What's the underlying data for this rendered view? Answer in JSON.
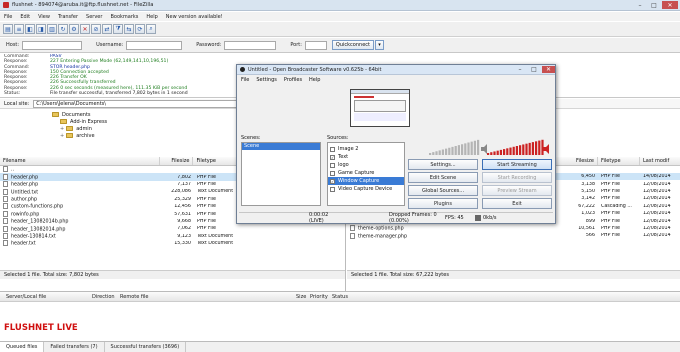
{
  "titlebar": {
    "title": "flushnet - 894074@aruba.it@ftp.flushnet.net - FileZilla"
  },
  "menu": [
    "File",
    "Edit",
    "View",
    "Transfer",
    "Server",
    "Bookmarks",
    "Help",
    "New version available!"
  ],
  "quickconnect": {
    "host_label": "Host:",
    "username_label": "Username:",
    "password_label": "Password:",
    "port_label": "Port:",
    "button": "Quickconnect"
  },
  "log": [
    {
      "k": "Command:",
      "v": "PASV",
      "t": "cmd"
    },
    {
      "k": "Response:",
      "v": "227 Entering Passive Mode (62,149,141,10,196,51)",
      "t": "ok"
    },
    {
      "k": "Command:",
      "v": "STOR header.php",
      "t": "cmd"
    },
    {
      "k": "Response:",
      "v": "150 Connection accepted",
      "t": "ok"
    },
    {
      "k": "Response:",
      "v": "226 Transfer OK",
      "t": "ok"
    },
    {
      "k": "Response:",
      "v": "226 Successfully transferred",
      "t": "ok"
    },
    {
      "k": "Response:",
      "v": "226 0 sec seconds (measured here), 111.35 KiB per second",
      "t": "ok"
    },
    {
      "k": "Status:",
      "v": "File transfer successful, transferred 7,802 bytes in 1 second",
      "t": "st"
    }
  ],
  "local": {
    "site_label": "Local site:",
    "path": "C:\\Users\\Jelena\\Documents\\",
    "tree": [
      "Documents",
      "Add-in Express",
      "admin",
      "archive"
    ],
    "columns": [
      "Filename",
      "Filesize",
      "Filetype"
    ],
    "files": [
      {
        "name": "..",
        "size": "",
        "type": ""
      },
      {
        "name": "header.php",
        "size": "7,802",
        "type": "PHP File",
        "sel": true
      },
      {
        "name": "header.php",
        "size": "7,137",
        "type": "PHP File"
      },
      {
        "name": "Untitled.txt",
        "size": "228,086",
        "type": "Text Document"
      },
      {
        "name": "author.php",
        "size": "25,329",
        "type": "PHP File"
      },
      {
        "name": "custom-functions.php",
        "size": "12,456",
        "type": "PHP File"
      },
      {
        "name": "rowinfo.php",
        "size": "57,631",
        "type": "PHP File"
      },
      {
        "name": "header_13082014b.php",
        "size": "9,668",
        "type": "PHP File"
      },
      {
        "name": "header_13082014.php",
        "size": "7,062",
        "type": "PHP File"
      },
      {
        "name": "header-130814.txt",
        "size": "9,123",
        "type": "Text Document"
      },
      {
        "name": "header.txt",
        "size": "15,330",
        "type": "Text Document"
      }
    ],
    "status": "Selected 1 file. Total size: 7,802 bytes"
  },
  "remote": {
    "columns": [
      "Filesize",
      "Filetype",
      "Last modif"
    ],
    "files": [
      {
        "name": "",
        "size": "6,450",
        "type": "PHP File",
        "mod": "14/08/2014",
        "sel": true
      },
      {
        "name": "",
        "size": "3,138",
        "type": "PHP File",
        "mod": "12/08/2014"
      },
      {
        "name": "",
        "size": "5,150",
        "type": "PHP File",
        "mod": "12/08/2014"
      },
      {
        "name": "",
        "size": "3,142",
        "type": "PHP File",
        "mod": "12/08/2014"
      },
      {
        "name": "",
        "size": "67,222",
        "type": "Cascading ...",
        "mod": "12/08/2014"
      },
      {
        "name": "wpdmanager.php",
        "size": "1,023",
        "type": "PHP File",
        "mod": "12/08/2014"
      },
      {
        "name": "tinytext.php",
        "size": "899",
        "type": "PHP File",
        "mod": "12/08/2014"
      },
      {
        "name": "theme-options.php",
        "size": "10,561",
        "type": "PHP File",
        "mod": "12/08/2014"
      },
      {
        "name": "theme-manager.php",
        "size": "566",
        "type": "PHP File",
        "mod": "12/08/2014"
      }
    ],
    "status": "Selected 1 file. Total size: 67,222 bytes"
  },
  "queue_cols": [
    "Server/Local file",
    "Direction",
    "Remote file",
    "Size",
    "Priority",
    "Status"
  ],
  "brand": "FLUSHNET LIVE",
  "bottom_tabs": [
    "Queued files",
    "Failed transfers (7)",
    "Successful transfers (3696)"
  ],
  "obs": {
    "title": "Untitled - Open Broadcaster Software v0.625b - 64bit",
    "menu": [
      "File",
      "Settings",
      "Profiles",
      "Help"
    ],
    "scenes_label": "Scenes:",
    "scenes": [
      "Scene"
    ],
    "sources_label": "Sources:",
    "sources": [
      {
        "name": "Image 2",
        "checked": false
      },
      {
        "name": "Text",
        "checked": true
      },
      {
        "name": "logo",
        "checked": false
      },
      {
        "name": "Game Capture",
        "checked": false
      },
      {
        "name": "Window Capture",
        "checked": true,
        "sel": true
      },
      {
        "name": "Video Capture Device",
        "checked": false
      }
    ],
    "buttons": {
      "settings": "Settings...",
      "start": "Start Streaming",
      "edit_scene": "Edit Scene",
      "start_rec": "Start Recording",
      "global": "Global Sources...",
      "preview": "Preview Stream",
      "plugins": "Plugins",
      "exit": "Exit"
    },
    "status": {
      "time": "0:00:02 (LIVE)",
      "dropped": "Dropped Frames: 0 (0.00%)",
      "fps": "FPS: 45",
      "kbps": "0kb/s"
    },
    "accent": "#cc2222"
  }
}
